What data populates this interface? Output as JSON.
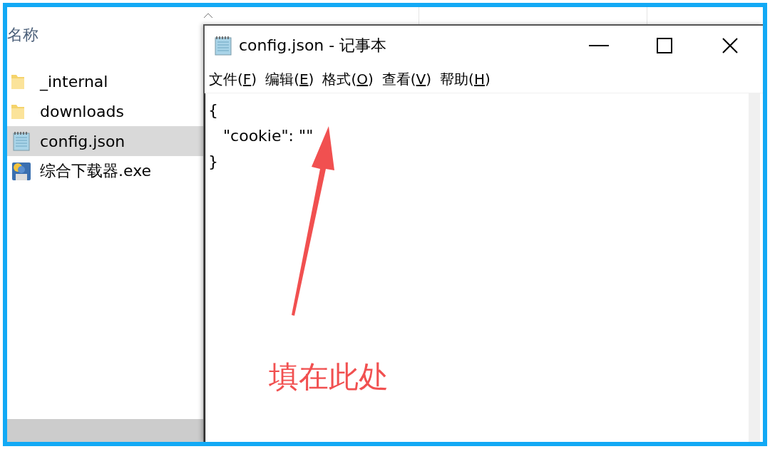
{
  "explorer": {
    "column_header": "名称",
    "files": [
      {
        "name": "_internal",
        "kind": "folder",
        "selected": false
      },
      {
        "name": "downloads",
        "kind": "folder",
        "selected": false
      },
      {
        "name": "config.json",
        "kind": "notepad",
        "selected": true
      },
      {
        "name": "综合下载器.exe",
        "kind": "program",
        "selected": false
      }
    ]
  },
  "notepad": {
    "title": "config.json - 记事本",
    "menu": [
      "文件(F)",
      "编辑(E)",
      "格式(O)",
      "查看(V)",
      "帮助(H)"
    ],
    "lines": [
      "{",
      "   \"cookie\": \"\"",
      "}"
    ]
  },
  "annotation": {
    "text": "填在此处"
  }
}
